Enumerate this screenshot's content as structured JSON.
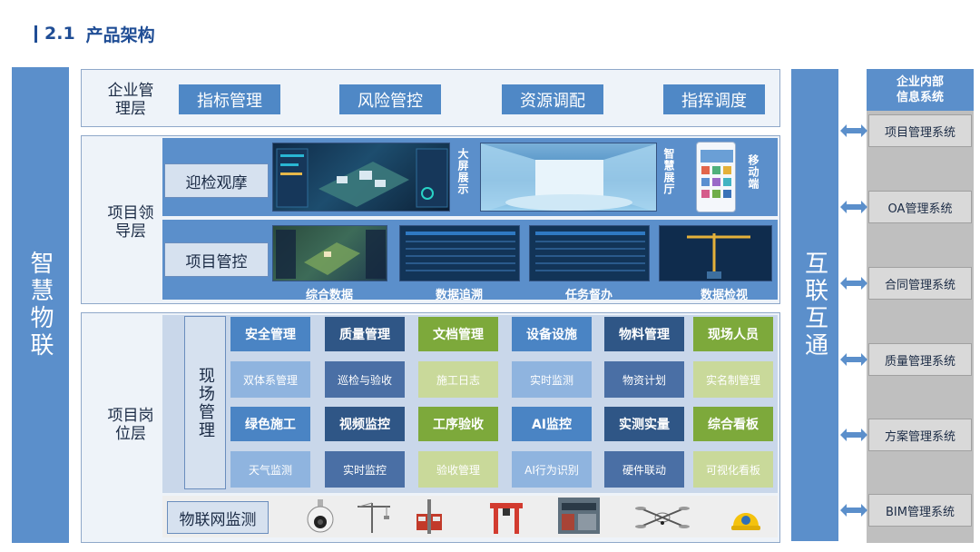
{
  "header": {
    "number": "2.1",
    "title": "产品架构"
  },
  "left_bar": "智慧物联",
  "right_bar": "互联互通",
  "mgmt_layer": {
    "label": "企业管理层",
    "buttons": [
      "指标管理",
      "风险管控",
      "资源调配",
      "指挥调度"
    ]
  },
  "lead_layer": {
    "label": "项目领导层",
    "row1": {
      "button": "迎检观摩",
      "screens": [
        {
          "label": "大屏展示"
        },
        {
          "label": "智慧展厅"
        },
        {
          "label": "移动端"
        }
      ]
    },
    "row2": {
      "button": "项目管控",
      "screens": [
        {
          "label": "综合数据"
        },
        {
          "label": "数据追溯"
        },
        {
          "label": "任务督办"
        },
        {
          "label": "数据检视"
        }
      ]
    }
  },
  "post_layer": {
    "label": "项目岗位层",
    "field_mgmt": "现场管理",
    "top_headers": [
      "安全管理",
      "质量管理",
      "文档管理",
      "设备设施",
      "物料管理",
      "现场人员"
    ],
    "top_subs": [
      "双体系管理",
      "巡检与验收",
      "施工日志",
      "实时监测",
      "物资计划",
      "实名制管理"
    ],
    "bottom_headers": [
      "绿色施工",
      "视频监控",
      "工序验收",
      "AI监控",
      "实测实量",
      "综合看板"
    ],
    "bottom_subs": [
      "天气监测",
      "实时监控",
      "验收管理",
      "AI行为识别",
      "硬件联动",
      "可视化看板"
    ],
    "iot": {
      "button": "物联网监测",
      "icons": [
        "camera-icon",
        "tower-crane-icon",
        "hoist-icon",
        "gantry-crane-icon",
        "site-photo-icon",
        "drone-icon",
        "helmet-icon"
      ]
    }
  },
  "systems": {
    "header": "企业内部信息系统",
    "items": [
      "项目管理系统",
      "OA管理系统",
      "合同管理系统",
      "质量管理系统",
      "方案管理系统",
      "BIM管理系统"
    ]
  },
  "colors": {
    "primary": "#5b8fcb",
    "navy": "#2f5686",
    "green": "#7da93b",
    "title": "#1f4d95"
  }
}
